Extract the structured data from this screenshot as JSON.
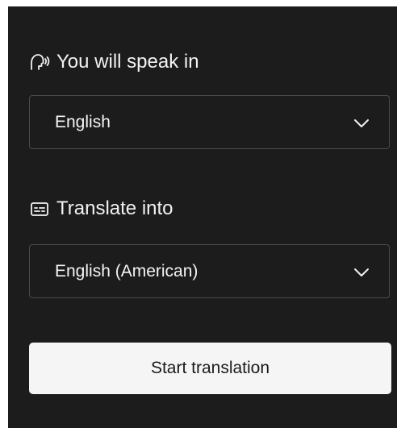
{
  "speak": {
    "label": "You will speak in",
    "icon": "speaking-head-icon",
    "selected": "English"
  },
  "translate": {
    "label": "Translate into",
    "icon": "captions-icon",
    "selected": "English (American)"
  },
  "actions": {
    "start_label": "Start translation"
  },
  "colors": {
    "panel_bg": "#1c1c1c",
    "text": "#f2f2f2",
    "border": "#4a4a4a",
    "button_bg": "#f5f5f5",
    "button_text": "#1a1a1a"
  }
}
